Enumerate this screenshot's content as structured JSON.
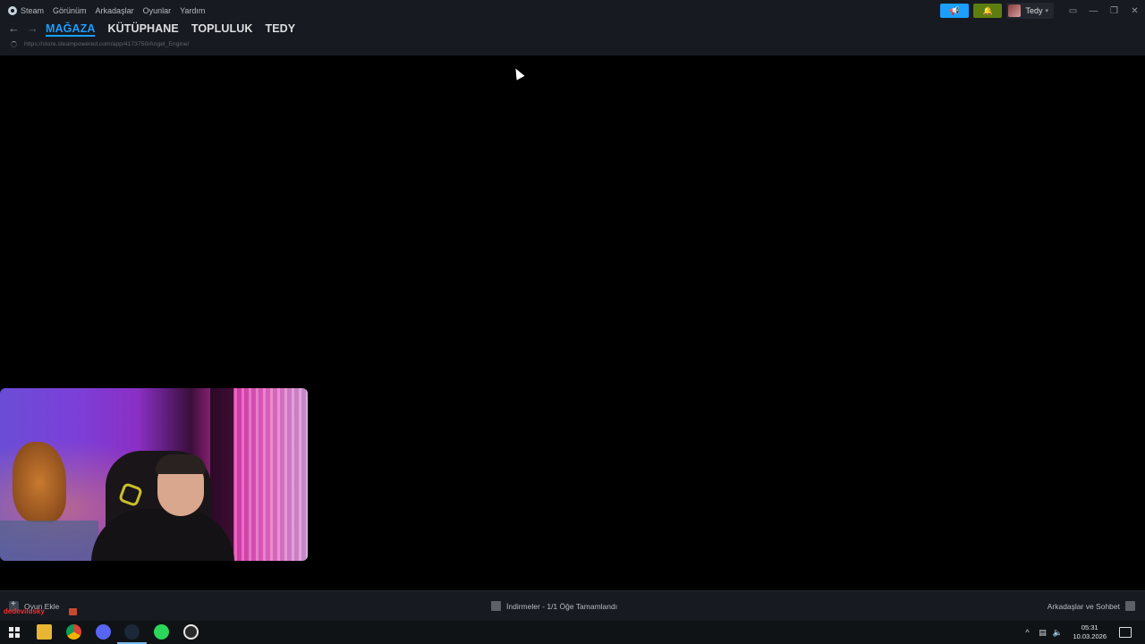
{
  "menu": {
    "items": [
      "Steam",
      "Görünüm",
      "Arkadaşlar",
      "Oyunlar",
      "Yardım"
    ]
  },
  "user": {
    "name": "Tedy"
  },
  "nav": {
    "tabs": [
      {
        "label": "MAĞAZA",
        "active": true
      },
      {
        "label": "KÜTÜPHANE",
        "active": false
      },
      {
        "label": "TOPLULUK",
        "active": false
      },
      {
        "label": "TEDY",
        "active": false
      }
    ],
    "url": "https://store.steampowered.com/app/4173750/Angel_Engine/"
  },
  "bottom": {
    "add_game": "Oyun Ekle",
    "overlay_name": "dedevilusky",
    "downloads": "İndirmeler - 1/1 Öğe Tamamlandı",
    "friends_chat": "Arkadaşlar ve Sohbet"
  },
  "taskbar": {
    "time": "05:31",
    "date": "10.03.2026",
    "apps": [
      "windows-start",
      "file-explorer",
      "chrome",
      "discord",
      "steam",
      "xbox-app",
      "obs"
    ]
  },
  "colors": {
    "accent": "#1a9fff",
    "notify": "#5c7e10",
    "chrome_bg": "#171a21"
  }
}
